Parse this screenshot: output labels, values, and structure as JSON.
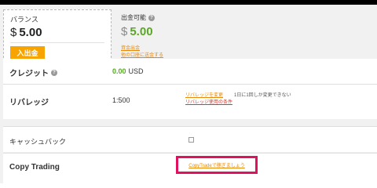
{
  "balance": {
    "label": "バランス",
    "currency_symbol": "$",
    "amount": "5.00",
    "deposit_button": "入出金"
  },
  "withdrawable": {
    "label": "出金可能",
    "info_icon": "info-icon",
    "currency_symbol": "$",
    "amount": "5.00",
    "link_withdraw": "資金出金",
    "link_transfer": "他の口座に送金する"
  },
  "credit": {
    "label": "クレジット",
    "info_icon": "info-icon",
    "value": "0.00",
    "unit": "USD"
  },
  "leverage": {
    "label": "リバレッジ",
    "value": "1:500",
    "change_link": "リバレッジを変更",
    "note": "1日に1回しか変更できない",
    "conditions_link": "リバレッジ使用の条件"
  },
  "cashback": {
    "label": "キャッシュバック",
    "checked": false
  },
  "copy_trading": {
    "label": "Copy Trading",
    "link": "CopyTradeで稼ぎましょう",
    "highlight_color": "#e0115f"
  },
  "colors": {
    "accent_orange": "#f7a400",
    "link_orange": "#e8890a",
    "positive_green": "#5aa626",
    "link_red": "#d9392b"
  }
}
